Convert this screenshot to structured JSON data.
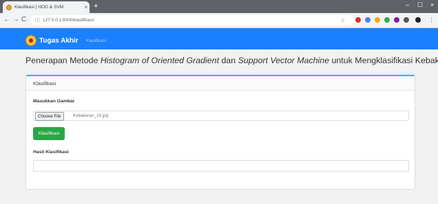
{
  "browser": {
    "tab_title": "Klasifikasi | HOG & SVM",
    "tab_close": "×",
    "new_tab": "+",
    "url": "127.0.0.1:8000/klasifikasi/",
    "back": "←",
    "forward": "→",
    "reload": "C",
    "info_glyph": "ⓘ",
    "star": "☆",
    "window_controls": {
      "minimize": "–",
      "maximize": "☐",
      "close": "×"
    },
    "extension_icons": [
      "#d93025",
      "#4285f4",
      "#f9ab00",
      "#34a853",
      "#202124"
    ]
  },
  "navbar": {
    "brand": "Tugas Akhir",
    "link": "Klasifikasi",
    "color": "#1a80ff"
  },
  "page": {
    "heading_parts": {
      "p1": "Penerapan Metode ",
      "p2": "Histogram of Oriented Gradient",
      "p3": " dan ",
      "p4": "Support Vector Machine",
      "p5": " untuk Mengklasifikasi Kebakaran"
    },
    "card": {
      "header": "Klasifikasi",
      "input_label": "Masukkan Gambar",
      "choose_file": "Choose File",
      "file_name": "Kebakaran_18.jpg",
      "submit": "Klasifikasi",
      "submit_color": "#28a745",
      "result_label": "Hasil Klasifikasi",
      "result_value": ""
    }
  }
}
